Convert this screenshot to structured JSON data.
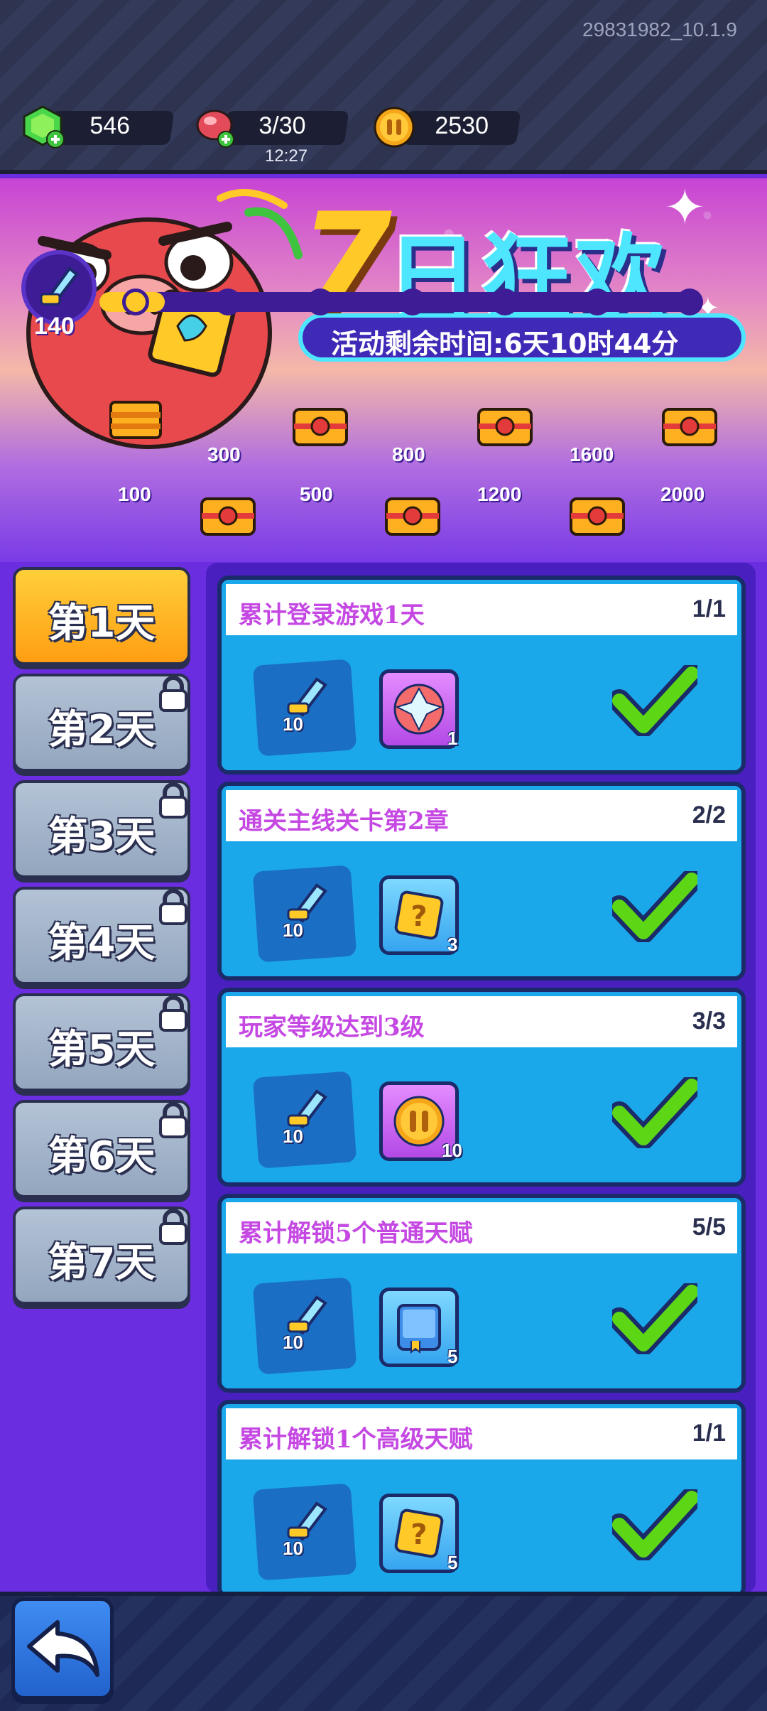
{
  "version": "29831982_10.1.9",
  "resources": {
    "gems": "546",
    "energy": "3/30",
    "energy_timer": "12:27",
    "coins": "2530"
  },
  "banner": {
    "title_number": "7",
    "title_text": "日狂欢",
    "countdown": "活动剩余时间:6天10时44分"
  },
  "progress": {
    "current_points": "140",
    "fill_fraction": 0.05,
    "milestones_bottom": [
      "100",
      "500",
      "1200",
      "2000"
    ],
    "milestones_top": [
      "300",
      "800",
      "1600"
    ]
  },
  "days": [
    "第1天",
    "第2天",
    "第3天",
    "第4天",
    "第5天",
    "第6天",
    "第7天"
  ],
  "tasks": [
    {
      "title": "累计登录游戏1天",
      "progress": "1/1",
      "reward1_qty": "10",
      "reward2_qty": "1",
      "reward2": "crystal-orb"
    },
    {
      "title": "通关主线关卡第2章",
      "progress": "2/2",
      "reward1_qty": "10",
      "reward2_qty": "3",
      "reward2": "mystery-box"
    },
    {
      "title": "玩家等级达到3级",
      "progress": "3/3",
      "reward1_qty": "10",
      "reward2_qty": "10",
      "reward2": "coin"
    },
    {
      "title": "累计解锁5个普通天赋",
      "progress": "5/5",
      "reward1_qty": "10",
      "reward2_qty": "5",
      "reward2": "blue-book"
    },
    {
      "title": "累计解锁1个高级天赋",
      "progress": "1/1",
      "reward1_qty": "10",
      "reward2_qty": "5",
      "reward2": "mystery-box"
    }
  ],
  "colors": {
    "background": "#6a2de0",
    "task_card": "#1ba8ea",
    "task_title": "#c548e3",
    "active_tab": "#ffb020",
    "check": "#5cd615"
  }
}
